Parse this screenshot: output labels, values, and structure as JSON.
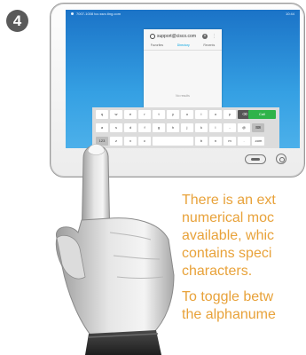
{
  "step": {
    "number": "4"
  },
  "device": {
    "statusbar": {
      "left_text": "7007-1008 tcc.ssrc.ting.com",
      "right_text": "10:44"
    },
    "search": {
      "query": "support@cisco.com",
      "clear_glyph": "×",
      "more_glyph": "⋮"
    },
    "tabs": [
      {
        "label": "Favorites",
        "active": false
      },
      {
        "label": "Directory",
        "active": true
      },
      {
        "label": "Recents",
        "active": false
      }
    ],
    "no_results_text": "No results",
    "keyboard": {
      "row1": [
        "q",
        "w",
        "e",
        "r",
        "t",
        "y",
        "u",
        "i",
        "o",
        "p"
      ],
      "row2": [
        "a",
        "s",
        "d",
        "f",
        "g",
        "h",
        "j",
        "k",
        "l",
        "-",
        "@"
      ],
      "row3": [
        "123",
        "z",
        "x",
        "c",
        "v",
        "",
        "",
        "b",
        "n",
        "m",
        ".",
        ".com"
      ],
      "call_label": "Call"
    }
  },
  "instructions": {
    "para1": [
      "There is an ext",
      "numerical moc",
      "available, whic",
      "contains speci",
      "characters."
    ],
    "para2": [
      "To toggle betw",
      "the alphanume"
    ]
  },
  "colors": {
    "instruction_text": "#e8a23a",
    "call_green": "#2fb34a",
    "screen_blue": "#1b73c7",
    "step_badge": "#5a5a5a"
  }
}
